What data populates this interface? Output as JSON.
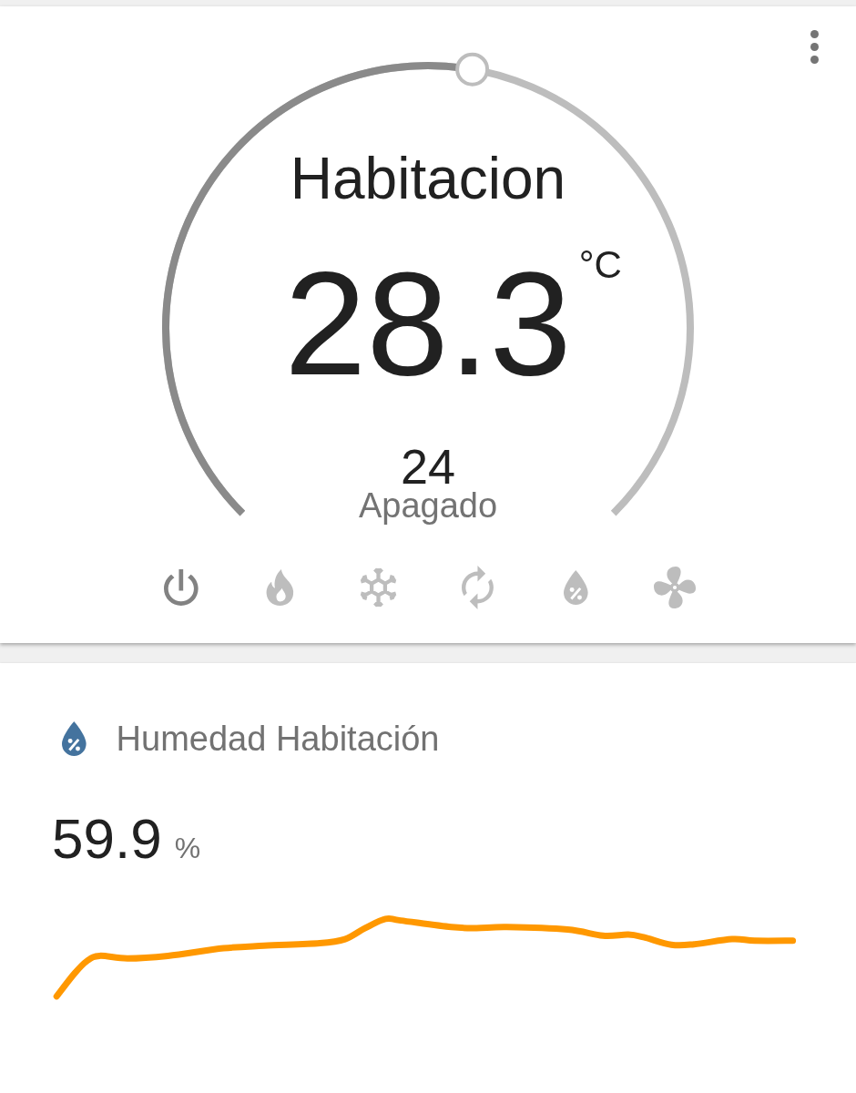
{
  "thermostat": {
    "name": "Habitacion",
    "current_temperature": "28.3",
    "unit": "°C",
    "target_temperature": "24",
    "hvac_state": "Apagado",
    "level": 0.536,
    "modes": [
      {
        "kind": "off",
        "selected": true
      },
      {
        "kind": "heat",
        "selected": false
      },
      {
        "kind": "cool",
        "selected": false
      },
      {
        "kind": "auto",
        "selected": false
      },
      {
        "kind": "dry",
        "selected": false
      },
      {
        "kind": "fan",
        "selected": false
      }
    ]
  },
  "sensor": {
    "name": "Humedad Habitación",
    "value": "59.9",
    "unit": "%"
  }
}
